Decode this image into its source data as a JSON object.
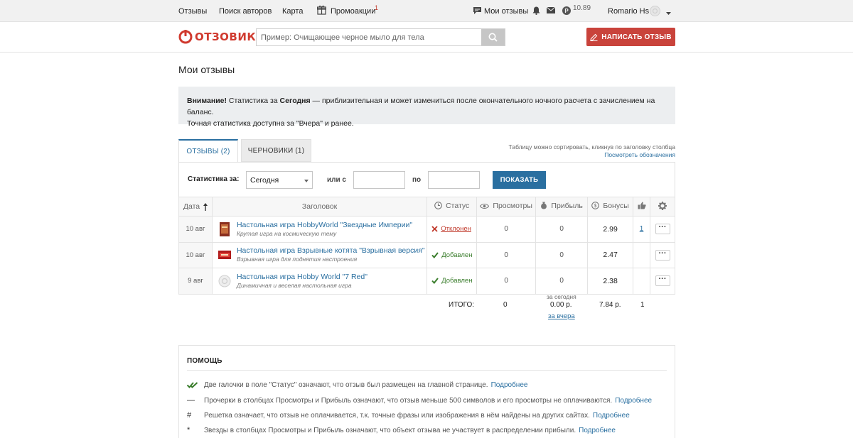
{
  "topbar": {
    "nav": [
      "Отзывы",
      "Поиск авторов",
      "Карта",
      "Промоакции"
    ],
    "promo_badge": "1",
    "my_reviews": "Мои отзывы",
    "balance": "10.89",
    "user": "Romario Hs"
  },
  "header": {
    "logo": "ОТЗОВИК",
    "search_placeholder": "Пример: Очищающее черное мыло для тела",
    "write_button": "НАПИСАТЬ ОТЗЫВ"
  },
  "page_title": "Мои отзывы",
  "notice": {
    "strong1": "Внимание!",
    "text1": " Статистика за ",
    "strong2": "Сегодня",
    "text2": " — приблизительная и может измениться после окончательного ночного расчета с зачислением на баланс.",
    "line2": "Точная статистика доступна за \"Вчера\" и ранее."
  },
  "tabs": {
    "reviews": "ОТЗЫВЫ (2)",
    "drafts": "ЧЕРНОВИКИ (1)"
  },
  "table_hint": {
    "text": "Таблицу можно сортировать, кликнув по заголовку столбца",
    "link": "Посмотреть обозначения"
  },
  "filter": {
    "label": "Статистика за:",
    "period": "Сегодня",
    "or_from": "или с",
    "to": "по",
    "show": "ПОКАЗАТЬ"
  },
  "columns": {
    "date": "Дата",
    "title": "Заголовок",
    "status": "Статус",
    "views": "Просмотры",
    "profit": "Прибыль",
    "bonus": "Бонусы"
  },
  "rows": [
    {
      "date": "10 авг",
      "title": "Настольная игра HobbyWorld \"Звездные Империи\"",
      "subtitle": "Крутая игра на космическую тему",
      "status": "Отклонен",
      "views": "0",
      "profit": "0",
      "bonus": "2.99",
      "likes": "1"
    },
    {
      "date": "10 авг",
      "title": "Настольная игра Взрывные котята \"Взрывная версия\"",
      "subtitle": "Взрывная игра для поднятия настроения",
      "status": "Добавлен",
      "views": "0",
      "profit": "0",
      "bonus": "2.47",
      "likes": ""
    },
    {
      "date": "9 авг",
      "title": "Настольная игра Hobby World \"7 Red\"",
      "subtitle": "Динамичная и веселая настольная игра",
      "status": "Добавлен",
      "views": "0",
      "profit": "0",
      "bonus": "2.38",
      "likes": ""
    }
  ],
  "totals": {
    "label": "ИТОГО:",
    "views": "0",
    "today_label": "за сегодня",
    "profit": "0.00 р.",
    "yesterday_link": "за вчера",
    "bonus": "7.84 р.",
    "likes": "1"
  },
  "help": {
    "title": "ПОМОЩЬ",
    "more": "Подробнее",
    "items": [
      "Две галочки в поле \"Статус\" означают, что отзыв был размещен на главной странице.",
      "Прочерки в столбцах Просмотры и Прибыль означают, что отзыв меньше 500 символов и его просмотры не оплачиваются.",
      "Решетка означает, что отзыв не оплачивается, т.к. точные фразы или изображения в нём найдены на других сайтах.",
      "Звезды в столбцах Просмотры и Прибыль означают, что объект отзыва не участвует в распределении прибыли."
    ]
  },
  "colors": {
    "brand_red": "#c9433b",
    "link_blue": "#2a6fa0",
    "ok_green": "#3a7d2c",
    "reject_red": "#c0392b"
  }
}
